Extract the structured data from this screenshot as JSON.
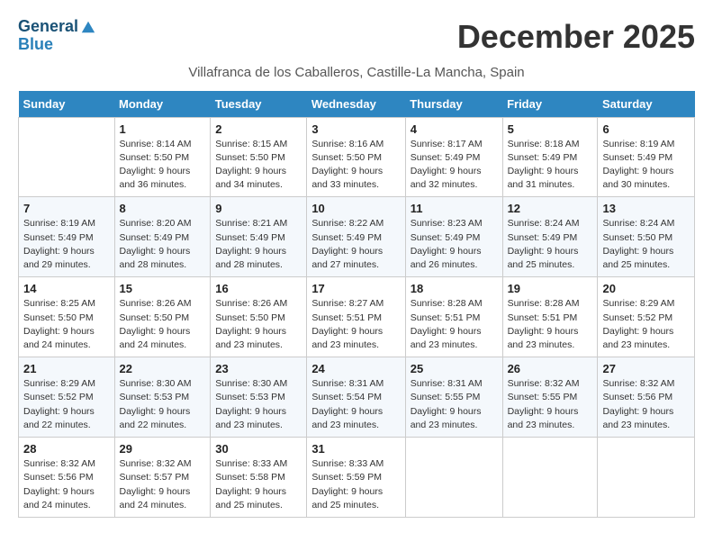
{
  "logo": {
    "line1": "General",
    "line2": "Blue"
  },
  "title": "December 2025",
  "subtitle": "Villafranca de los Caballeros, Castille-La Mancha, Spain",
  "days_of_week": [
    "Sunday",
    "Monday",
    "Tuesday",
    "Wednesday",
    "Thursday",
    "Friday",
    "Saturday"
  ],
  "weeks": [
    [
      {
        "day": "",
        "info": ""
      },
      {
        "day": "1",
        "info": "Sunrise: 8:14 AM\nSunset: 5:50 PM\nDaylight: 9 hours\nand 36 minutes."
      },
      {
        "day": "2",
        "info": "Sunrise: 8:15 AM\nSunset: 5:50 PM\nDaylight: 9 hours\nand 34 minutes."
      },
      {
        "day": "3",
        "info": "Sunrise: 8:16 AM\nSunset: 5:50 PM\nDaylight: 9 hours\nand 33 minutes."
      },
      {
        "day": "4",
        "info": "Sunrise: 8:17 AM\nSunset: 5:49 PM\nDaylight: 9 hours\nand 32 minutes."
      },
      {
        "day": "5",
        "info": "Sunrise: 8:18 AM\nSunset: 5:49 PM\nDaylight: 9 hours\nand 31 minutes."
      },
      {
        "day": "6",
        "info": "Sunrise: 8:19 AM\nSunset: 5:49 PM\nDaylight: 9 hours\nand 30 minutes."
      }
    ],
    [
      {
        "day": "7",
        "info": "Sunrise: 8:19 AM\nSunset: 5:49 PM\nDaylight: 9 hours\nand 29 minutes."
      },
      {
        "day": "8",
        "info": "Sunrise: 8:20 AM\nSunset: 5:49 PM\nDaylight: 9 hours\nand 28 minutes."
      },
      {
        "day": "9",
        "info": "Sunrise: 8:21 AM\nSunset: 5:49 PM\nDaylight: 9 hours\nand 28 minutes."
      },
      {
        "day": "10",
        "info": "Sunrise: 8:22 AM\nSunset: 5:49 PM\nDaylight: 9 hours\nand 27 minutes."
      },
      {
        "day": "11",
        "info": "Sunrise: 8:23 AM\nSunset: 5:49 PM\nDaylight: 9 hours\nand 26 minutes."
      },
      {
        "day": "12",
        "info": "Sunrise: 8:24 AM\nSunset: 5:49 PM\nDaylight: 9 hours\nand 25 minutes."
      },
      {
        "day": "13",
        "info": "Sunrise: 8:24 AM\nSunset: 5:50 PM\nDaylight: 9 hours\nand 25 minutes."
      }
    ],
    [
      {
        "day": "14",
        "info": "Sunrise: 8:25 AM\nSunset: 5:50 PM\nDaylight: 9 hours\nand 24 minutes."
      },
      {
        "day": "15",
        "info": "Sunrise: 8:26 AM\nSunset: 5:50 PM\nDaylight: 9 hours\nand 24 minutes."
      },
      {
        "day": "16",
        "info": "Sunrise: 8:26 AM\nSunset: 5:50 PM\nDaylight: 9 hours\nand 23 minutes."
      },
      {
        "day": "17",
        "info": "Sunrise: 8:27 AM\nSunset: 5:51 PM\nDaylight: 9 hours\nand 23 minutes."
      },
      {
        "day": "18",
        "info": "Sunrise: 8:28 AM\nSunset: 5:51 PM\nDaylight: 9 hours\nand 23 minutes."
      },
      {
        "day": "19",
        "info": "Sunrise: 8:28 AM\nSunset: 5:51 PM\nDaylight: 9 hours\nand 23 minutes."
      },
      {
        "day": "20",
        "info": "Sunrise: 8:29 AM\nSunset: 5:52 PM\nDaylight: 9 hours\nand 23 minutes."
      }
    ],
    [
      {
        "day": "21",
        "info": "Sunrise: 8:29 AM\nSunset: 5:52 PM\nDaylight: 9 hours\nand 22 minutes."
      },
      {
        "day": "22",
        "info": "Sunrise: 8:30 AM\nSunset: 5:53 PM\nDaylight: 9 hours\nand 22 minutes."
      },
      {
        "day": "23",
        "info": "Sunrise: 8:30 AM\nSunset: 5:53 PM\nDaylight: 9 hours\nand 23 minutes."
      },
      {
        "day": "24",
        "info": "Sunrise: 8:31 AM\nSunset: 5:54 PM\nDaylight: 9 hours\nand 23 minutes."
      },
      {
        "day": "25",
        "info": "Sunrise: 8:31 AM\nSunset: 5:55 PM\nDaylight: 9 hours\nand 23 minutes."
      },
      {
        "day": "26",
        "info": "Sunrise: 8:32 AM\nSunset: 5:55 PM\nDaylight: 9 hours\nand 23 minutes."
      },
      {
        "day": "27",
        "info": "Sunrise: 8:32 AM\nSunset: 5:56 PM\nDaylight: 9 hours\nand 23 minutes."
      }
    ],
    [
      {
        "day": "28",
        "info": "Sunrise: 8:32 AM\nSunset: 5:56 PM\nDaylight: 9 hours\nand 24 minutes."
      },
      {
        "day": "29",
        "info": "Sunrise: 8:32 AM\nSunset: 5:57 PM\nDaylight: 9 hours\nand 24 minutes."
      },
      {
        "day": "30",
        "info": "Sunrise: 8:33 AM\nSunset: 5:58 PM\nDaylight: 9 hours\nand 25 minutes."
      },
      {
        "day": "31",
        "info": "Sunrise: 8:33 AM\nSunset: 5:59 PM\nDaylight: 9 hours\nand 25 minutes."
      },
      {
        "day": "",
        "info": ""
      },
      {
        "day": "",
        "info": ""
      },
      {
        "day": "",
        "info": ""
      }
    ]
  ]
}
